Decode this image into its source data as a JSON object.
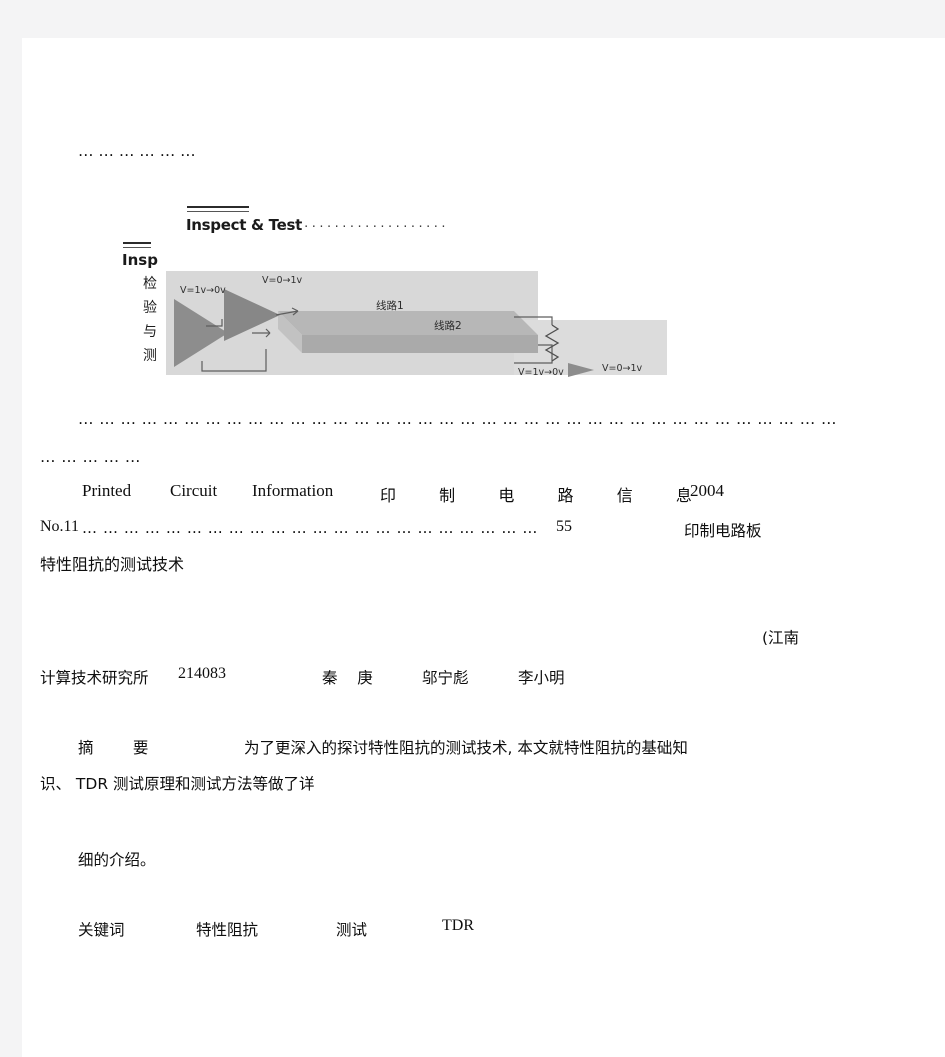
{
  "document": {
    "kind": "scanned-journal-page",
    "page_background": "#ffffff",
    "app_background": "#f4f4f5"
  },
  "toc_dots": {
    "row1": "… … … … … …",
    "row2": "… … … … … … … … … … … … … … … … … … … … … … … … … … … … … … … … … … … …",
    "row3": "… … … … …"
  },
  "figure": {
    "caption_en": "Inspect & Test",
    "caption_leader": "······················",
    "running_head_en": "Insp",
    "running_head_cn": [
      "检",
      "验",
      "与",
      "测"
    ],
    "labels": {
      "left_driver": "V=1v→0v",
      "second_driver": "V=0→1v",
      "trace1": "线路1",
      "trace2": "线路2",
      "far_left": "V=1v→0v",
      "far_right": "V=0→1v"
    },
    "colors": {
      "photo_fill": "#d8d8d8",
      "photo_ext_fill": "#dcdcdc",
      "trace_fill": "#b4b4b4",
      "triangle_fill": "#8d8d8d",
      "line_stroke": "#5a5a5a"
    }
  },
  "journal": {
    "title_en_1": "Printed",
    "title_en_2": "Circuit",
    "title_en_3": "Information",
    "title_cn": "印  制  电  路  信  息",
    "year": "2004",
    "issue": "No.11",
    "issue_leader": "… … … … … … … … … … … … … … … … … … … … … …",
    "page_number": "55",
    "section_cn": "印制电路板"
  },
  "article": {
    "title_cn": "特性阻抗的测试技术",
    "affiliation_open": "(江南",
    "affiliation_cn": "计算技术研究所",
    "postcode": "214083",
    "authors": [
      "秦    庚",
      "邬宁彪",
      "李小明"
    ],
    "abstract_label": "摘        要",
    "abstract_line1": "为了更深入的探讨特性阻抗的测试技术, 本文就特性阻抗的基础知",
    "abstract_line2": "识、 TDR 测试原理和测试方法等做了详",
    "abstract_line3": "细的介绍。",
    "keywords_label": "关键词",
    "keywords": [
      "特性阻抗",
      "测试",
      "TDR"
    ]
  }
}
